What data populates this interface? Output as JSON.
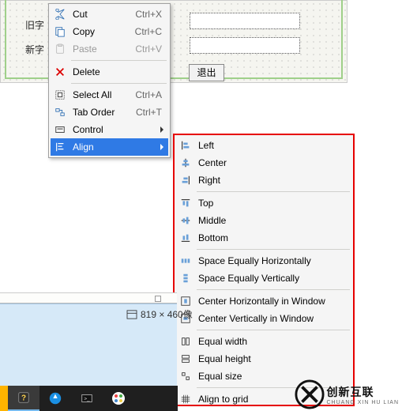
{
  "form": {
    "old_label_partial": "旧字",
    "new_label": "新字",
    "exit_button": "退出"
  },
  "menu": {
    "cut": {
      "label": "Cut",
      "shortcut": "Ctrl+X"
    },
    "copy": {
      "label": "Copy",
      "shortcut": "Ctrl+C"
    },
    "paste": {
      "label": "Paste",
      "shortcut": "Ctrl+V"
    },
    "delete": {
      "label": "Delete"
    },
    "select_all": {
      "label": "Select All",
      "shortcut": "Ctrl+A"
    },
    "tab_order": {
      "label": "Tab Order",
      "shortcut": "Ctrl+T"
    },
    "control": {
      "label": "Control"
    },
    "align": {
      "label": "Align"
    }
  },
  "align_submenu": {
    "left": "Left",
    "center": "Center",
    "right": "Right",
    "top": "Top",
    "middle": "Middle",
    "bottom": "Bottom",
    "space_h": "Space Equally Horizontally",
    "space_v": "Space Equally Vertically",
    "center_h_win": "Center Horizontally in Window",
    "center_v_win": "Center Vertically in Window",
    "eq_width": "Equal width",
    "eq_height": "Equal height",
    "eq_size": "Equal size",
    "align_grid": "Align to grid"
  },
  "status": {
    "dimensions": "819 × 460像"
  },
  "brand": {
    "cn": "创新互联",
    "en": "CHUANG XIN HU LIAN"
  }
}
